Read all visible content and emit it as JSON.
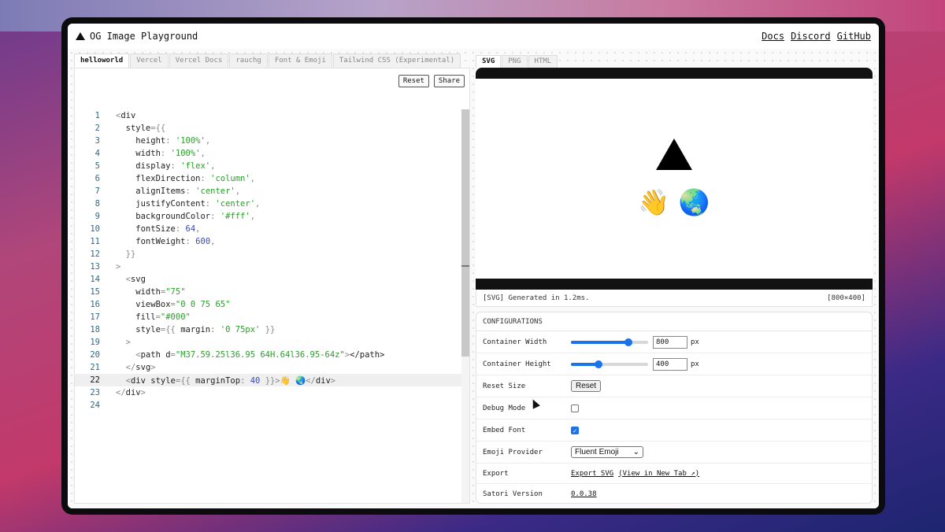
{
  "app": {
    "title": "OG Image Playground"
  },
  "nav": [
    "Docs",
    "Discord",
    "GitHub"
  ],
  "editor": {
    "tabs": [
      {
        "label": "helloworld",
        "active": true
      },
      {
        "label": "Vercel",
        "active": false
      },
      {
        "label": "Vercel Docs",
        "active": false
      },
      {
        "label": "rauchg",
        "active": false
      },
      {
        "label": "Font & Emoji",
        "active": false
      },
      {
        "label": "Tailwind CSS (Experimental)",
        "active": false
      }
    ],
    "reset_label": "Reset",
    "share_label": "Share",
    "current_line": 22,
    "lines": [
      [
        [
          "p",
          "<"
        ],
        [
          "k",
          "div"
        ]
      ],
      [
        [
          "k",
          "  style"
        ],
        [
          "p",
          "={{"
        ]
      ],
      [
        [
          "k",
          "    height"
        ],
        [
          "p",
          ": "
        ],
        [
          "s",
          "'100%'"
        ],
        [
          "p",
          ","
        ]
      ],
      [
        [
          "k",
          "    width"
        ],
        [
          "p",
          ": "
        ],
        [
          "s",
          "'100%'"
        ],
        [
          "p",
          ","
        ]
      ],
      [
        [
          "k",
          "    display"
        ],
        [
          "p",
          ": "
        ],
        [
          "s",
          "'flex'"
        ],
        [
          "p",
          ","
        ]
      ],
      [
        [
          "k",
          "    flexDirection"
        ],
        [
          "p",
          ": "
        ],
        [
          "s",
          "'column'"
        ],
        [
          "p",
          ","
        ]
      ],
      [
        [
          "k",
          "    alignItems"
        ],
        [
          "p",
          ": "
        ],
        [
          "s",
          "'center'"
        ],
        [
          "p",
          ","
        ]
      ],
      [
        [
          "k",
          "    justifyContent"
        ],
        [
          "p",
          ": "
        ],
        [
          "s",
          "'center'"
        ],
        [
          "p",
          ","
        ]
      ],
      [
        [
          "k",
          "    backgroundColor"
        ],
        [
          "p",
          ": "
        ],
        [
          "s",
          "'#fff'"
        ],
        [
          "p",
          ","
        ]
      ],
      [
        [
          "k",
          "    fontSize"
        ],
        [
          "p",
          ": "
        ],
        [
          "n",
          "64"
        ],
        [
          "p",
          ","
        ]
      ],
      [
        [
          "k",
          "    fontWeight"
        ],
        [
          "p",
          ": "
        ],
        [
          "n",
          "600"
        ],
        [
          "p",
          ","
        ]
      ],
      [
        [
          "p",
          "  }}"
        ]
      ],
      [
        [
          "p",
          ">"
        ]
      ],
      [
        [
          "p",
          "  <"
        ],
        [
          "k",
          "svg"
        ]
      ],
      [
        [
          "k",
          "    width"
        ],
        [
          "p",
          "="
        ],
        [
          "s",
          "\"75\""
        ]
      ],
      [
        [
          "k",
          "    viewBox"
        ],
        [
          "p",
          "="
        ],
        [
          "s",
          "\"0 0 75 65\""
        ]
      ],
      [
        [
          "k",
          "    fill"
        ],
        [
          "p",
          "="
        ],
        [
          "s",
          "\"#000\""
        ]
      ],
      [
        [
          "k",
          "    style"
        ],
        [
          "p",
          "={{ "
        ],
        [
          "k",
          "margin"
        ],
        [
          "p",
          ": "
        ],
        [
          "s",
          "'0 75px'"
        ],
        [
          "p",
          " }}"
        ]
      ],
      [
        [
          "p",
          "  >"
        ]
      ],
      [
        [
          "p",
          "    <"
        ],
        [
          "k",
          "path d"
        ],
        [
          "p",
          "="
        ],
        [
          "s",
          "\"M37.59.25l36.95 64H.64l36.95-64z\""
        ],
        [
          "p",
          ">"
        ],
        [
          "k",
          "</path>"
        ]
      ],
      [
        [
          "p",
          "  </"
        ],
        [
          "k",
          "svg"
        ],
        [
          "p",
          ">"
        ]
      ],
      [
        [
          "p",
          "  <"
        ],
        [
          "k",
          "div style"
        ],
        [
          "p",
          "={{ "
        ],
        [
          "k",
          "marginTop"
        ],
        [
          "p",
          ": "
        ],
        [
          "n",
          "40"
        ],
        [
          "p",
          " }}>"
        ],
        [
          "k",
          "👋 🌏"
        ],
        [
          "p",
          "</"
        ],
        [
          "k",
          "div"
        ],
        [
          "p",
          ">"
        ]
      ],
      [
        [
          "p",
          "</"
        ],
        [
          "k",
          "div"
        ],
        [
          "p",
          ">"
        ]
      ],
      []
    ]
  },
  "preview": {
    "tabs": [
      {
        "label": "SVG",
        "active": true
      },
      {
        "label": "PNG",
        "active": false
      },
      {
        "label": "HTML",
        "active": false
      }
    ],
    "emoji": [
      "👋",
      "🌏"
    ],
    "status": "[SVG] Generated in 1.2ms.",
    "size": "[800×400]"
  },
  "config": {
    "heading": "CONFIGURATIONS",
    "container_width": {
      "label": "Container Width",
      "value": "800",
      "unit": "px",
      "fraction": 0.74
    },
    "container_height": {
      "label": "Container Height",
      "value": "400",
      "unit": "px",
      "fraction": 0.36
    },
    "reset_size": {
      "label": "Reset Size",
      "button": "Reset"
    },
    "debug_mode": {
      "label": "Debug Mode",
      "checked": false
    },
    "embed_font": {
      "label": "Embed Font",
      "checked": true
    },
    "emoji_provider": {
      "label": "Emoji Provider",
      "value": "Fluent Emoji"
    },
    "export": {
      "label": "Export",
      "svg_link": "Export SVG",
      "tab_link": "(View in New Tab ↗)"
    },
    "satori": {
      "label": "Satori Version",
      "value": "0.0.38"
    }
  },
  "colors": {
    "accent": "#1a73e8",
    "string": "#2a9d2a",
    "number": "#3b4ab8",
    "line_number": "#2d6a86"
  }
}
